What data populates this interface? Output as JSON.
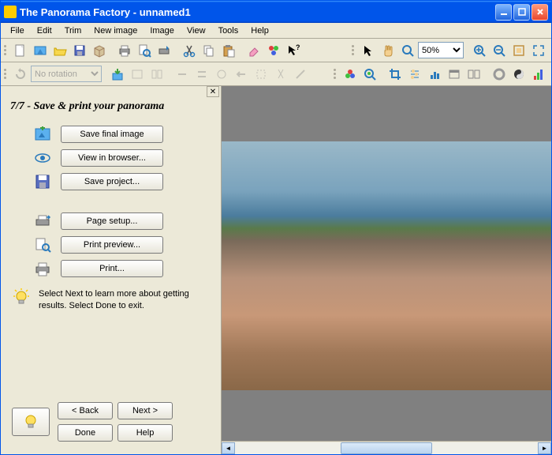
{
  "title": "The Panorama Factory - unnamed1",
  "menu": [
    "File",
    "Edit",
    "Trim",
    "New image",
    "Image",
    "View",
    "Tools",
    "Help"
  ],
  "toolbar2": {
    "rotation": "No rotation"
  },
  "toolbar3": {
    "zoom": "50%"
  },
  "wizard": {
    "title": "7/7 - Save & print your panorama",
    "buttons": {
      "save_final": "Save final image",
      "view_browser": "View in browser...",
      "save_project": "Save project...",
      "page_setup": "Page setup...",
      "print_preview": "Print preview...",
      "print": "Print..."
    },
    "hint": "Select Next to learn more about getting results. Select Done to exit.",
    "nav": {
      "back": "< Back",
      "next": "Next >",
      "done": "Done",
      "help": "Help"
    }
  }
}
